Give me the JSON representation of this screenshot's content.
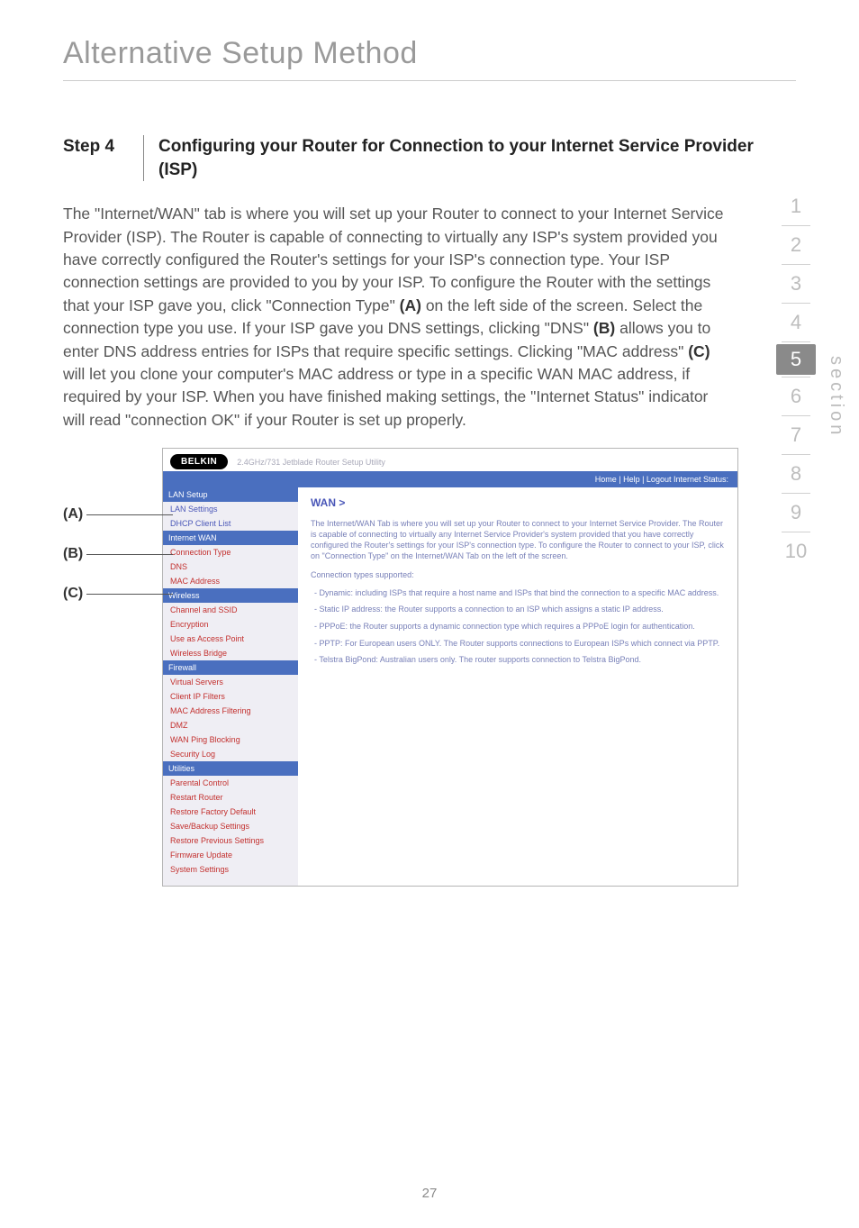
{
  "chapter_title": "Alternative Setup Method",
  "step": {
    "label": "Step 4",
    "title": "Configuring your Router for Connection to your Internet Service Provider (ISP)"
  },
  "body_html": "The \"Internet/WAN\" tab is where you will set up your Router to connect to your Internet Service Provider (ISP). The Router is capable of connecting to virtually any ISP's system provided you have correctly configured the Router's settings for your ISP's connection type. Your ISP connection settings are provided to you by your ISP. To configure the Router with the settings that your ISP gave you, click \"Connection Type\" (A) on the left side of the screen. Select the connection type you use. If your ISP gave you DNS settings, clicking \"DNS\" (B) allows you to enter DNS address entries for ISPs that require specific settings. Clicking \"MAC address\" (C) will let you clone your computer's MAC address or type in a specific WAN MAC address, if required by your ISP. When you have finished making settings, the \"Internet Status\" indicator will read \"connection OK\" if your Router is set up properly.",
  "callouts": {
    "a": "(A)",
    "b": "(B)",
    "c": "(C)"
  },
  "nav": {
    "items": [
      "1",
      "2",
      "3",
      "4",
      "5",
      "6",
      "7",
      "8",
      "9",
      "10"
    ],
    "current": "5",
    "label": "section"
  },
  "admin": {
    "brand": "BELKIN",
    "top_text": "2.4GHz/731 Jetblade Router Setup Utility",
    "bluebar": "Home | Help | Logout     Internet Status:",
    "sidebar": {
      "groups": [
        {
          "head": "LAN Setup",
          "links": [
            "LAN Settings",
            "DHCP Client List"
          ]
        },
        {
          "head": "Internet WAN",
          "links": [
            "Connection Type",
            "DNS",
            "MAC Address"
          ]
        },
        {
          "head": "Wireless",
          "links": [
            "Channel and SSID",
            "Encryption",
            "Use as Access Point",
            "Wireless Bridge"
          ]
        },
        {
          "head": "Firewall",
          "links": [
            "Virtual Servers",
            "Client IP Filters",
            "MAC Address Filtering",
            "DMZ",
            "WAN Ping Blocking",
            "Security Log"
          ]
        },
        {
          "head": "Utilities",
          "links": [
            "Parental Control",
            "Restart Router",
            "Restore Factory Default",
            "Save/Backup Settings",
            "Restore Previous Settings",
            "Firmware Update",
            "System Settings"
          ]
        }
      ]
    },
    "main": {
      "title": "WAN >",
      "intro": "The Internet/WAN Tab is where you will set up your Router to connect to your Internet Service Provider. The Router is capable of connecting to virtually any Internet Service Provider's system provided that you have correctly configured the Router's settings for your ISP's connection type. To configure the Router to connect to your ISP, click on \"Connection Type\" on the Internet/WAN Tab on the left of the screen.",
      "sub": "Connection types supported:",
      "items": [
        "Dynamic: including ISPs that require a host name and ISPs that bind the connection to a specific MAC address.",
        "Static IP address: the Router supports a connection to an ISP which assigns a static IP address.",
        "PPPoE: the Router supports a dynamic connection type which requires a PPPoE login for authentication.",
        "PPTP: For European users ONLY. The Router supports connections to European ISPs which connect via PPTP.",
        "Telstra BigPond: Australian users only. The router supports connection to Telstra BigPond."
      ]
    }
  },
  "page_number": "27"
}
